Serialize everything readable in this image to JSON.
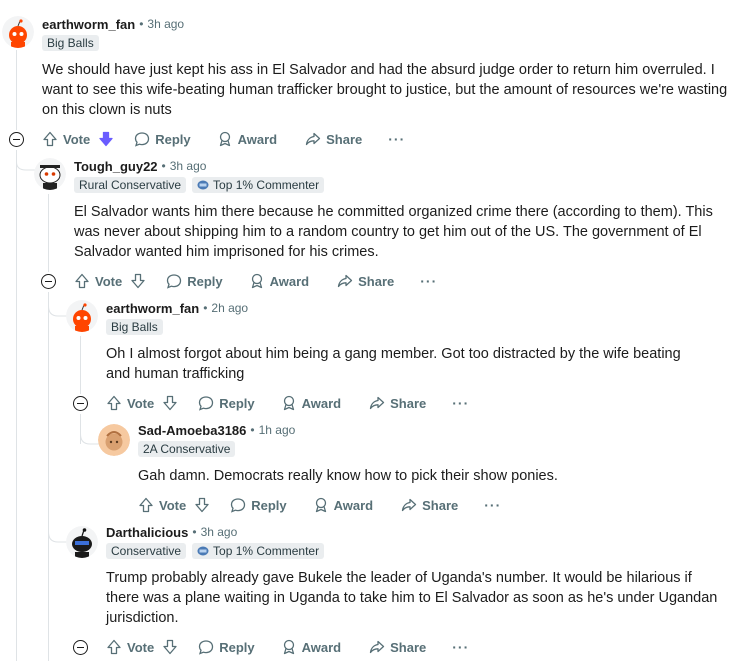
{
  "comments": [
    {
      "username": "earthworm_fan",
      "time": "3h ago",
      "flair": "Big Balls",
      "body": "We should have just kept his ass in El Salvador and had the absurd judge order to return him overruled. I want to see this wife-beating human trafficker brought to justice, but the amount of resources we're wasting on this clown is nuts",
      "vote_state": "downvoted"
    },
    {
      "username": "Tough_guy22",
      "time": "3h ago",
      "flair": "Rural Conservative",
      "badge": "Top 1% Commenter",
      "body": "El Salvador wants him there because he committed organized crime there (according to them). This was never about shipping him to a random country to get him out of the US. The government of El Salvador wanted him imprisoned for his crimes."
    },
    {
      "username": "earthworm_fan",
      "time": "2h ago",
      "flair": "Big Balls",
      "body": "Oh I almost forgot about him being a gang member. Got too distracted by the wife beating and human trafficking"
    },
    {
      "username": "Sad-Amoeba3186",
      "time": "1h ago",
      "flair": "2A Conservative",
      "body": "Gah damn. Democrats really know how to pick their show ponies."
    },
    {
      "username": "Darthalicious",
      "time": "3h ago",
      "flair": "Conservative",
      "badge": "Top 1% Commenter",
      "body": "Trump probably already gave Bukele the leader of Uganda's number. It would be hilarious if there was a plane waiting in Uganda to take him to El Salvador as soon as he's under Ugandan jurisdiction."
    }
  ],
  "actions": {
    "vote": "Vote",
    "reply": "Reply",
    "award": "Award",
    "share": "Share",
    "more": "···"
  },
  "meta_separator": "•",
  "colors": {
    "downvote": "#6a5cff",
    "meta": "#576f76",
    "flair_bg": "#eaedef",
    "thread_line": "#dfe3e6"
  },
  "icons": [
    "reddit-snoo-avatar",
    "upvote-icon",
    "downvote-icon",
    "reply-icon",
    "award-icon",
    "share-icon",
    "more-icon",
    "collapse-icon",
    "top-commenter-badge-icon"
  ]
}
